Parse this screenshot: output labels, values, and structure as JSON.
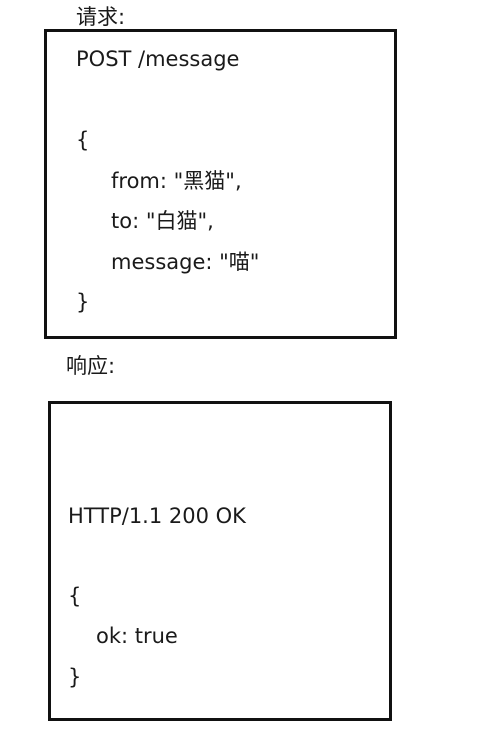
{
  "request": {
    "label": "请求:",
    "lines": [
      "POST /message",
      "{",
      "from: \"黑猫\",",
      "to: \"白猫\",",
      "message: \"喵\"",
      "}"
    ]
  },
  "response": {
    "label": "响应:",
    "lines": [
      "HTTP/1.1 200 OK",
      "{",
      "ok: true",
      "}"
    ]
  }
}
